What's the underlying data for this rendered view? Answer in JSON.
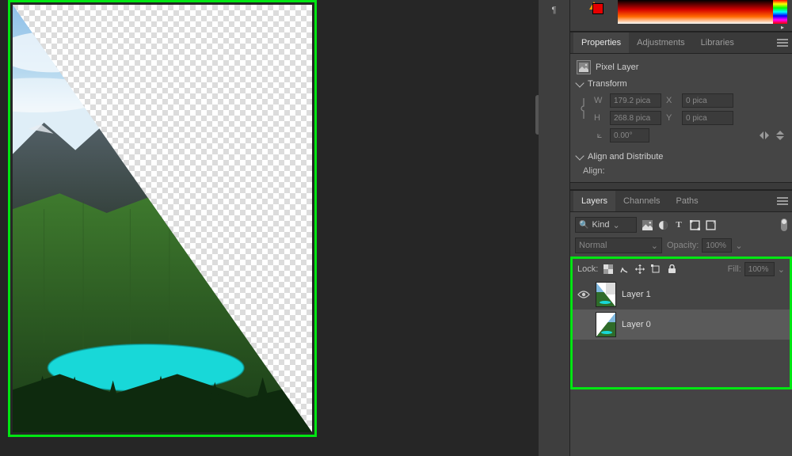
{
  "strip": {
    "paragraph_icon": "paragraph-panel-icon"
  },
  "color_panel": {
    "swatch_color": "#e60000"
  },
  "panels": {
    "properties": {
      "tabs": [
        "Properties",
        "Adjustments",
        "Libraries"
      ],
      "active_tab": 0,
      "layer_type_label": "Pixel Layer",
      "transform_heading": "Transform",
      "transform": {
        "w_label": "W",
        "w_value": "179.2 pica",
        "h_label": "H",
        "h_value": "268.8 pica",
        "x_label": "X",
        "x_value": "0 pica",
        "y_label": "Y",
        "y_value": "0 pica",
        "angle_value": "0.00°"
      },
      "align_heading": "Align and Distribute",
      "align_label": "Align:"
    },
    "layers": {
      "tabs": [
        "Layers",
        "Channels",
        "Paths"
      ],
      "active_tab": 0,
      "kind_label": "Kind",
      "blend_mode": "Normal",
      "opacity_label": "Opacity:",
      "opacity_value": "100%",
      "lock_label": "Lock:",
      "fill_label": "Fill:",
      "fill_value": "100%",
      "items": [
        {
          "name": "Layer 1",
          "visible": true,
          "selected": false
        },
        {
          "name": "Layer 0",
          "visible": false,
          "selected": true
        }
      ]
    }
  },
  "highlight_color": "#00e612"
}
